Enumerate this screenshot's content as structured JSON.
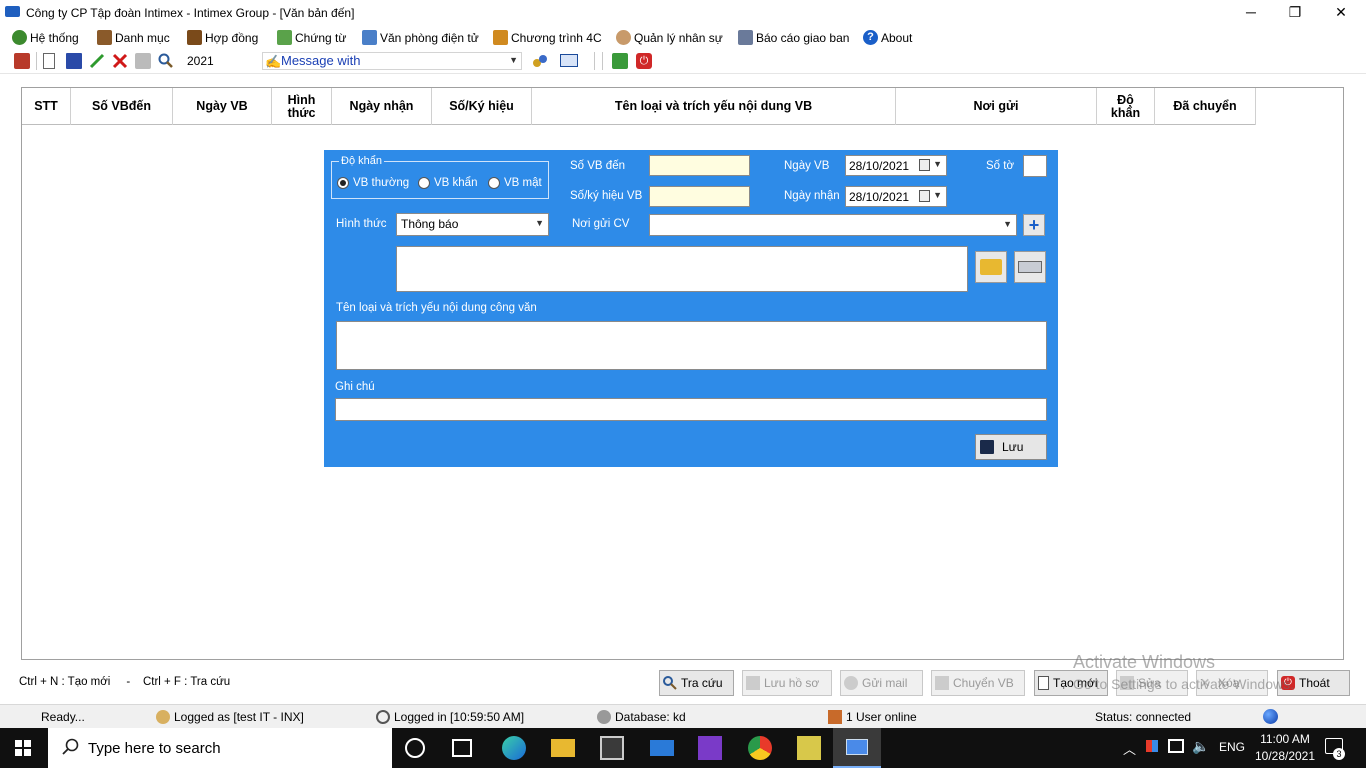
{
  "window": {
    "title": "Công ty CP Tập đoàn Intimex - Intimex Group - [Văn bản đến]",
    "minimize": "─",
    "restore": "❐",
    "close": "✕"
  },
  "menu": [
    {
      "label": "Hệ thống",
      "icon": "system-icon",
      "color": "#3c8a2e"
    },
    {
      "label": "Danh mục",
      "icon": "catalog-icon",
      "color": "#8a5a2a"
    },
    {
      "label": "Hợp đồng",
      "icon": "contract-icon",
      "color": "#7a4a1a"
    },
    {
      "label": "Chứng từ",
      "icon": "voucher-icon",
      "color": "#5aa24a"
    },
    {
      "label": "Văn phòng điện tử",
      "icon": "office-icon",
      "color": "#4a7fc8"
    },
    {
      "label": "Chương trình 4C",
      "icon": "program-icon",
      "color": "#d08a20"
    },
    {
      "label": "Quản lý nhân sự",
      "icon": "hr-icon",
      "color": "#c89a6a"
    },
    {
      "label": "Báo cáo giao ban",
      "icon": "report-icon",
      "color": "#6a7a9a"
    },
    {
      "label": "About",
      "icon": "help-icon",
      "color": "#1a5fc8"
    }
  ],
  "toolbar": {
    "year": "2021",
    "message_label": "Message with"
  },
  "grid": {
    "columns": [
      "STT",
      "Số VBđến",
      "Ngày VB",
      "Hình thức",
      "Ngày nhận",
      "Số/Ký hiệu",
      "Tên loại và trích yếu nội dung VB",
      "Nơi gửi",
      "Độ khẩn",
      "Đã chuyển"
    ]
  },
  "form": {
    "urgency_legend": "Độ khẩn",
    "radios": [
      {
        "label": "VB thường",
        "checked": true
      },
      {
        "label": "VB khẩn",
        "checked": false
      },
      {
        "label": "VB mật",
        "checked": false
      }
    ],
    "so_vb_den_label": "Số VB đến",
    "so_ky_hieu_label": "Số/ký hiệu VB",
    "ngay_vb_label": "Ngày VB",
    "ngay_vb_value": "28/10/2021",
    "ngay_nhan_label": "Ngày nhận",
    "ngay_nhan_value": "28/10/2021",
    "so_to_label": "Số tờ",
    "hinh_thuc_label": "Hình thức",
    "hinh_thuc_value": "Thông báo",
    "noi_gui_label": "Nơi gửi CV",
    "noi_gui_value": "",
    "trich_yeu_label": "Tên loại và trích yếu nội dung công văn",
    "ghi_chu_label": "Ghi chú",
    "save_label": "Lưu",
    "background": "#2e8be8"
  },
  "footer": {
    "hint": "Ctrl + N : Tạo mới     -    Ctrl + F : Tra cứu",
    "buttons": [
      {
        "label": "Tra cứu",
        "enabled": true
      },
      {
        "label": "Lưu hồ sơ",
        "enabled": false
      },
      {
        "label": "Gửi mail",
        "enabled": false
      },
      {
        "label": "Chuyển VB",
        "enabled": false
      },
      {
        "label": "Tạo mới",
        "enabled": true
      },
      {
        "label": "Sửa",
        "enabled": false
      },
      {
        "label": "Xóa",
        "enabled": false
      },
      {
        "label": "Thoát",
        "enabled": true
      }
    ],
    "watermark_title": "Activate Windows",
    "watermark_sub": "Go to Settings to activate Windows."
  },
  "status": {
    "ready": "Ready...",
    "logged_as": "Logged as [test IT - INX]",
    "logged_in": "Logged in [10:59:50 AM]",
    "database": "Database: kd",
    "users": "1 User online",
    "connection": "Status: connected"
  },
  "taskbar": {
    "search_placeholder": "Type here to search",
    "language": "ENG",
    "time": "11:00 AM",
    "date": "10/28/2021",
    "notifications": "3"
  }
}
